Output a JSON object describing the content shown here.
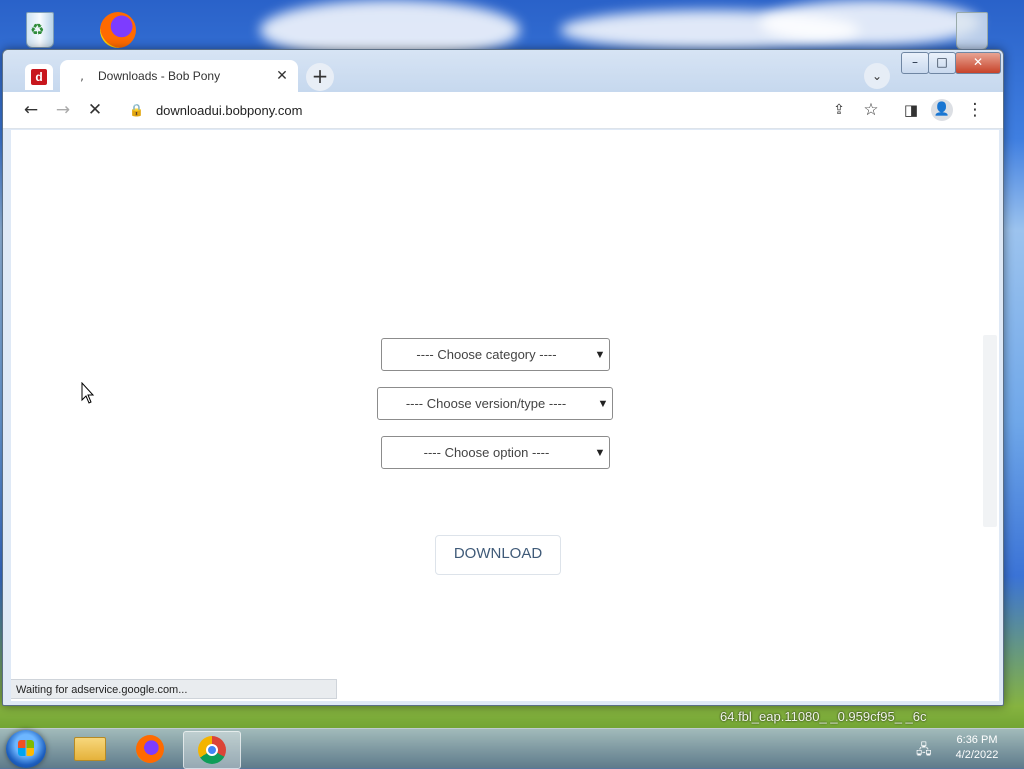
{
  "desktop": {
    "background_text": "64.fbl_eap.11080_ _0.959cf95_ _6c"
  },
  "browser": {
    "tab": {
      "title": "Downloads - Bob Pony",
      "spinner": ",",
      "close_glyph": "✕"
    },
    "new_tab_glyph": "+",
    "tab_search_glyph": "⌄",
    "window_controls": {
      "minimize": "–",
      "maximize": "□",
      "close": "✕"
    },
    "toolbar": {
      "back_glyph": "←",
      "forward_glyph": "→",
      "stop_glyph": "✕",
      "url": "downloadui.bobpony.com",
      "share_glyph": "⇪",
      "bookmark_glyph": "☆",
      "sidepanel_glyph": "◨",
      "profile_glyph": "👤",
      "menu_glyph": "⋮"
    },
    "status_text": "Waiting for adservice.google.com..."
  },
  "page": {
    "selects": {
      "category": "---- Choose category ----",
      "version": "---- Choose version/type ----",
      "option": "---- Choose option ----"
    },
    "download_label": "DOWNLOAD"
  },
  "taskbar": {
    "time": "6:36 PM",
    "date": "4/2/2022"
  },
  "colors": {
    "accent": "#3f5a78",
    "close_button": "#c7432a"
  }
}
